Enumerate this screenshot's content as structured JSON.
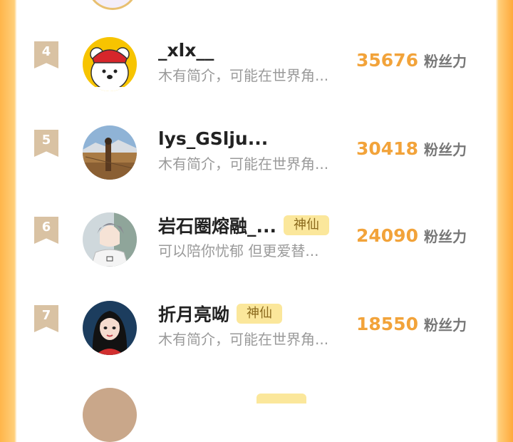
{
  "list": {
    "rows": [
      {
        "rank": "4",
        "name": "_xlx__",
        "badge": "",
        "bio": "木有简介，可能在世界角...",
        "score": "35676",
        "unit": "粉丝力",
        "avatar": "teddy-bear-avatar"
      },
      {
        "rank": "5",
        "name": "lys_GSlju...",
        "badge": "",
        "bio": "木有简介，可能在世界角...",
        "score": "30418",
        "unit": "粉丝力",
        "avatar": "landscape-avatar"
      },
      {
        "rank": "6",
        "name": "岩石圈熔融_...",
        "badge": "神仙",
        "bio": "可以陪你忧郁 但更爱替...",
        "score": "24090",
        "unit": "粉丝力",
        "avatar": "anime-boy-avatar"
      },
      {
        "rank": "7",
        "name": "折月亮呦",
        "badge": "神仙",
        "bio": "木有简介，可能在世界角...",
        "score": "18550",
        "unit": "粉丝力",
        "avatar": "girl-portrait-avatar"
      }
    ]
  },
  "colors": {
    "accent": "#f2a33a",
    "badge_bg": "#fbe79b",
    "rank_flag": "#d9c2a3",
    "border_orange": "#ffb54a"
  }
}
